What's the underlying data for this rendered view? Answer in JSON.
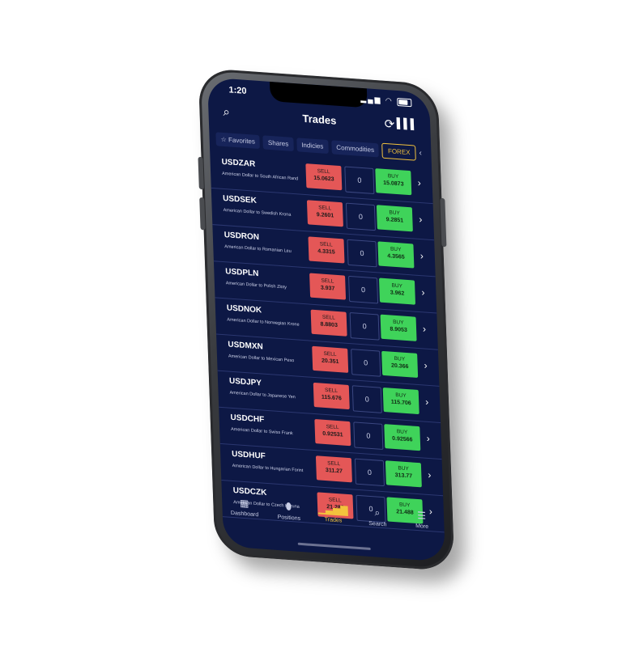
{
  "status": {
    "time": "1:20"
  },
  "header": {
    "title": "Trades",
    "icons": [
      "search-icon",
      "refresh-icon",
      "chart-icon"
    ]
  },
  "tabs": [
    {
      "label": "Favorites",
      "icon": "star-icon"
    },
    {
      "label": "Shares"
    },
    {
      "label": "Indicies"
    },
    {
      "label": "Commodities"
    },
    {
      "label": "FOREX",
      "active": true
    }
  ],
  "trade_labels": {
    "sell": "SELL",
    "buy": "BUY"
  },
  "pairs": [
    {
      "symbol": "USDZAR",
      "desc": "American Dollar to South African Rand",
      "sell": "15.0623",
      "spread": "0",
      "buy": "15.0873"
    },
    {
      "symbol": "USDSEK",
      "desc": "American Dollar to Swedish Krona",
      "sell": "9.2601",
      "spread": "0",
      "buy": "9.2851"
    },
    {
      "symbol": "USDRON",
      "desc": "American Dollar to Romanian Leu",
      "sell": "4.3315",
      "spread": "0",
      "buy": "4.3565"
    },
    {
      "symbol": "USDPLN",
      "desc": "American Dollar to Polish Zloty",
      "sell": "3.937",
      "spread": "0",
      "buy": "3.962"
    },
    {
      "symbol": "USDNOK",
      "desc": "American Dollar to Norwegian Krone",
      "sell": "8.8803",
      "spread": "0",
      "buy": "8.9053"
    },
    {
      "symbol": "USDMXN",
      "desc": "American Dollar to Mexican Peso",
      "sell": "20.351",
      "spread": "0",
      "buy": "20.366"
    },
    {
      "symbol": "USDJPY",
      "desc": "American Dollar to Japanese Yen",
      "sell": "115.676",
      "spread": "0",
      "buy": "115.706"
    },
    {
      "symbol": "USDCHF",
      "desc": "American Dollar to Swiss Frank",
      "sell": "0.92531",
      "spread": "0",
      "buy": "0.92566"
    },
    {
      "symbol": "USDHUF",
      "desc": "American Dollar to Hungarian Forint",
      "sell": "311.27",
      "spread": "0",
      "buy": "313.77"
    },
    {
      "symbol": "USDCZK",
      "desc": "American Dollar to Czech Koruna",
      "sell": "21.288",
      "spread": "0",
      "buy": "21.488"
    }
  ],
  "nav": [
    {
      "label": "Dashboard",
      "icon": "grid-icon"
    },
    {
      "label": "Positions",
      "icon": "pin-icon"
    },
    {
      "label": "Trades",
      "icon": "bars-icon",
      "active": true
    },
    {
      "label": "Search",
      "icon": "search-icon"
    },
    {
      "label": "More",
      "icon": "menu-icon"
    }
  ],
  "colors": {
    "background": "#0d1845",
    "sell": "#e45757",
    "buy": "#3fd35a",
    "accent": "#f3c33d"
  }
}
